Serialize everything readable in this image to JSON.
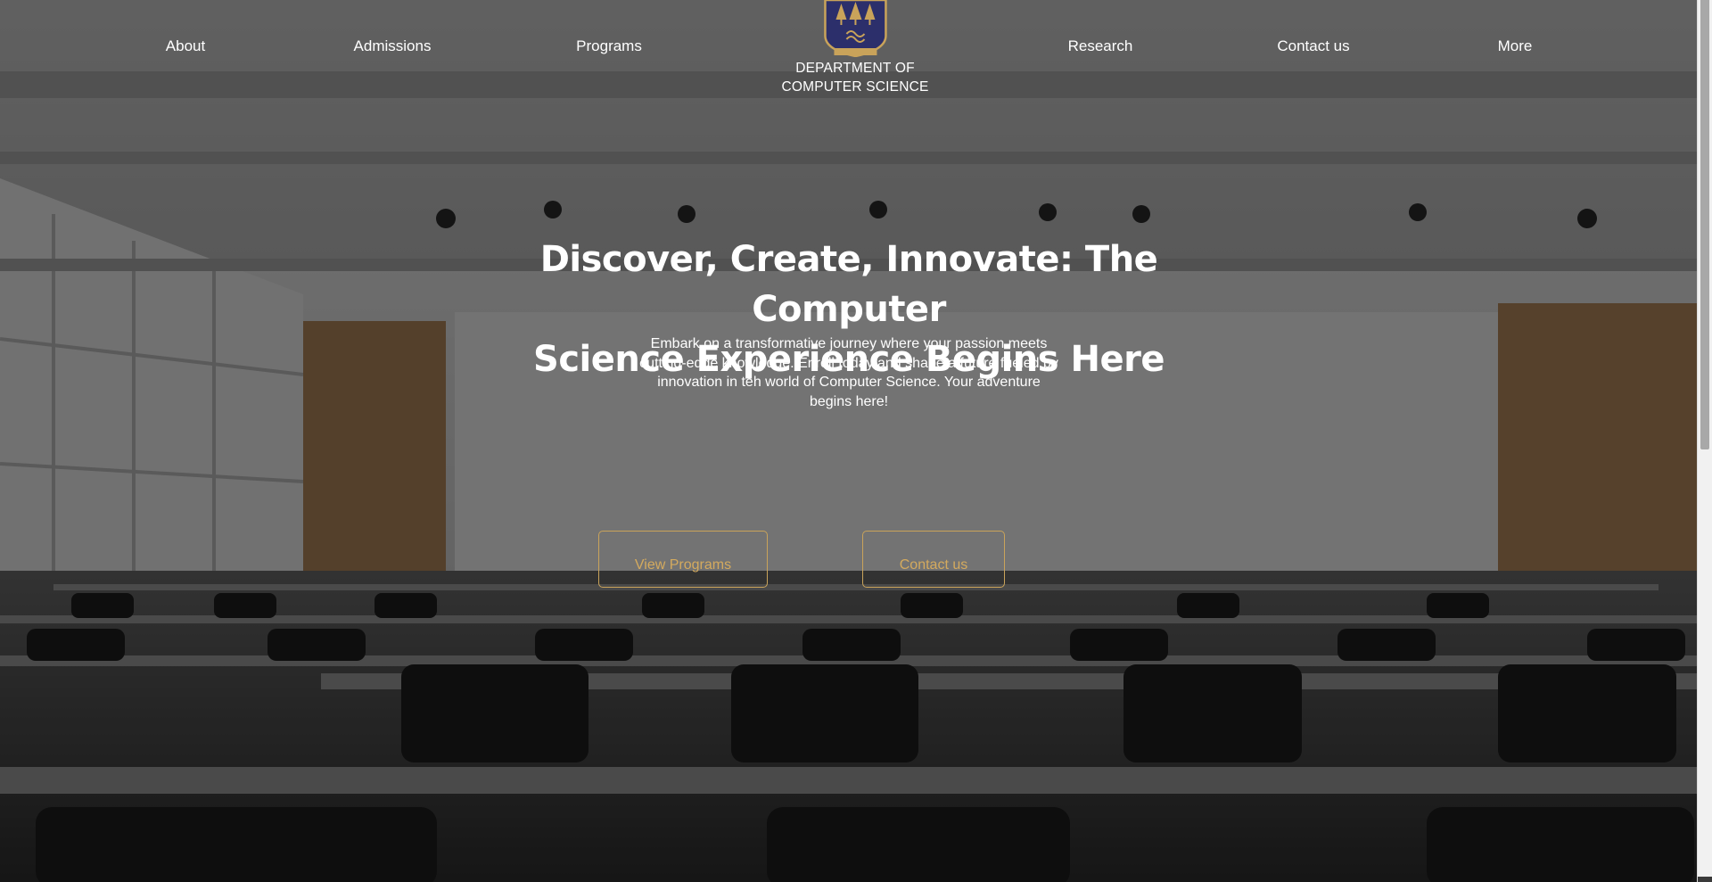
{
  "nav": {
    "items_left": [
      {
        "label": "About"
      },
      {
        "label": "Admissions"
      },
      {
        "label": "Programs"
      }
    ],
    "items_right": [
      {
        "label": "Research"
      },
      {
        "label": "Contact us"
      },
      {
        "label": "More"
      }
    ],
    "brand": {
      "line1": "DEPARTMENT OF",
      "line2": "COMPUTER SCIENCE"
    }
  },
  "hero": {
    "title_line1": "Discover, Create, Innovate: The Computer",
    "title_line2": "Science Experience Begins Here",
    "subtitle": "Embark on a transformative journey where your passion meets cutting-edge knowledge. Enroll today and shape a future fueled by innovation in teh world of Computer Science. Your adventure begins here!",
    "buttons": {
      "programs": "View Programs",
      "contact": "Contact us"
    }
  },
  "colors": {
    "accent": "#d4aa5e",
    "text": "#ffffff",
    "overlay": "rgba(0,0,0,0.52)",
    "crest_blue": "#2c2f6b",
    "crest_gold": "#c9a35a"
  },
  "icons": {
    "crest": "department-crest-icon"
  }
}
